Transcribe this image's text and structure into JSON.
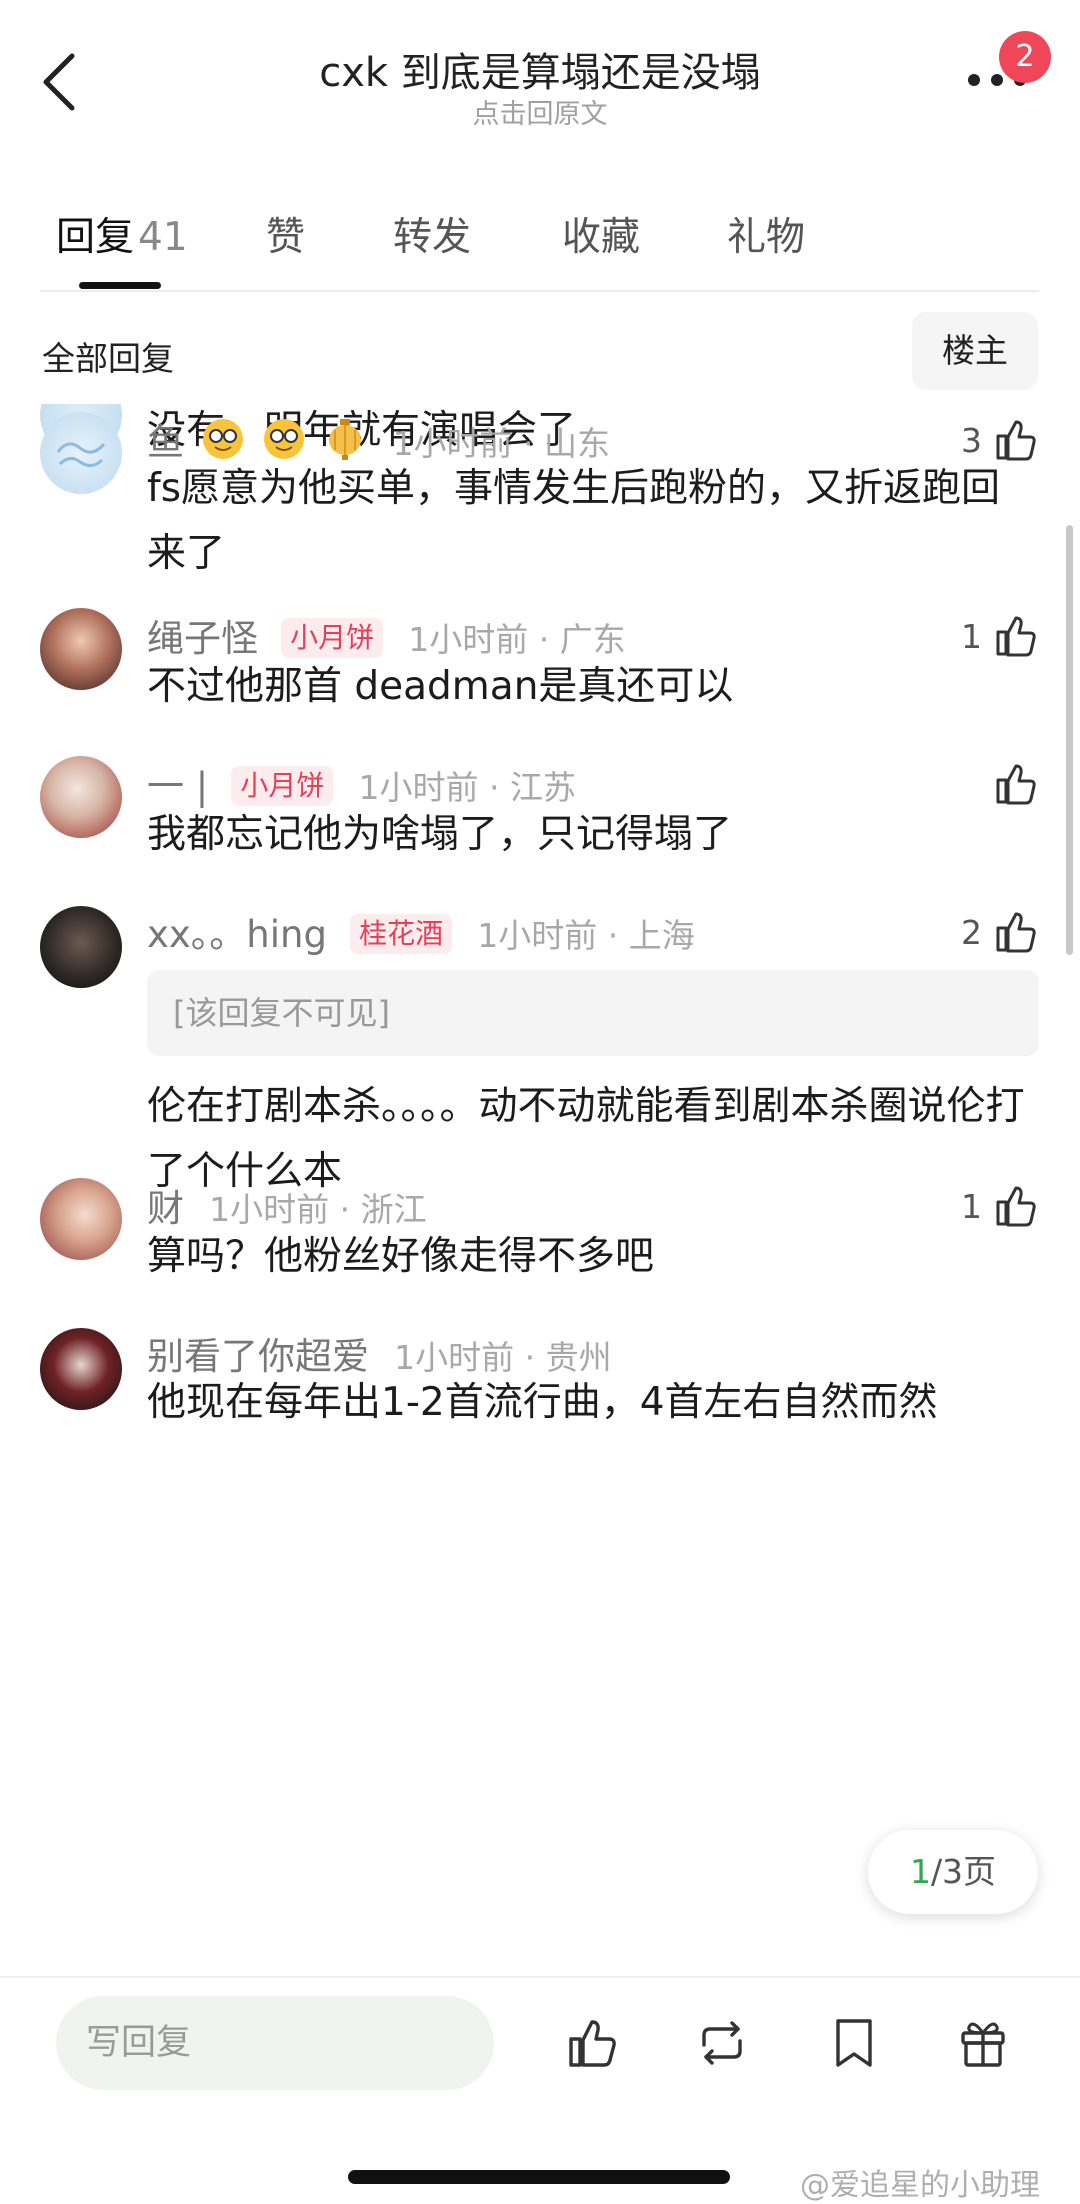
{
  "header": {
    "title": "cxk 到底是算塌还是没塌",
    "subtitle": "点击回原文",
    "notification_count": "2"
  },
  "tabs": [
    {
      "label": "回复",
      "count": "41"
    },
    {
      "label": "赞"
    },
    {
      "label": "转发"
    },
    {
      "label": "收藏"
    },
    {
      "label": "礼物"
    }
  ],
  "filter": {
    "label": "全部回复",
    "op_button": "楼主"
  },
  "comments": [
    {
      "username": "",
      "time_location": "",
      "likes": "",
      "body": "没有，明年就有演唱会了"
    },
    {
      "username": "鱼",
      "time_location": "1小时前 · 山东",
      "likes": "3",
      "body": "fs愿意为他买单，事情发生后跑粉的，又折返跑回来了"
    },
    {
      "username": "绳子怪",
      "tag": "小月饼",
      "time_location": "1小时前 · 广东",
      "likes": "1",
      "body": "不过他那首 deadman是真还可以"
    },
    {
      "username": "一 |",
      "tag": "小月饼",
      "time_location": "1小时前 · 江苏",
      "likes": "",
      "body": "我都忘记他为啥塌了，只记得塌了"
    },
    {
      "username": "xx。。hing",
      "tag": "桂花酒",
      "time_location": "1小时前 · 上海",
      "likes": "2",
      "quoted": "[该回复不可见]",
      "body": "伦在打剧本杀。。。。动不动就能看到剧本杀圈说伦打了个什么本"
    },
    {
      "username": "财",
      "time_location": "1小时前 · 浙江",
      "likes": "1",
      "body": "算吗？他粉丝好像走得不多吧"
    },
    {
      "username": "别看了你超爱",
      "time_location": "1小时前 · 贵州",
      "likes": "",
      "body": "他现在每年出1-2首流行曲，4首左右自然而然"
    }
  ],
  "pagination": {
    "current": "1",
    "total_text": "/3页"
  },
  "bottom_bar": {
    "reply_placeholder": "写回复"
  },
  "watermark": "@爱追星的小助理",
  "colors": {
    "tag_text": "#e3405a",
    "tag_bg": "#fdecee",
    "badge": "#f0465a",
    "page_current": "#2fa84f"
  }
}
